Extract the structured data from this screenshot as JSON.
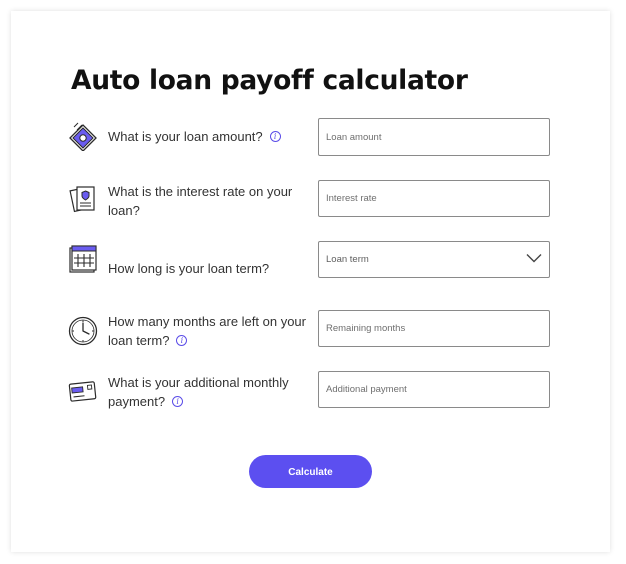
{
  "title": "Auto loan payoff calculator",
  "colors": {
    "accent": "#5c4ff0",
    "text": "#333333",
    "border": "#8a8a8a"
  },
  "fields": [
    {
      "icon": "money-bill-icon",
      "question": "What is your loan amount?",
      "has_info": true,
      "placeholder": "Loan amount"
    },
    {
      "icon": "rate-document-icon",
      "question": "What is the interest rate on your loan?",
      "has_info": false,
      "placeholder": "Interest rate"
    },
    {
      "icon": "calendar-icon",
      "question": "How long is your loan term?",
      "has_info": false,
      "selected": "Loan term"
    },
    {
      "icon": "clock-icon",
      "question": "How many months are left on your loan term?",
      "has_info": true,
      "placeholder": "Remaining months"
    },
    {
      "icon": "credit-card-icon",
      "question": "What is your additional monthly payment?",
      "has_info": true,
      "placeholder": "Additional payment"
    }
  ],
  "button": {
    "label": "Calculate"
  }
}
